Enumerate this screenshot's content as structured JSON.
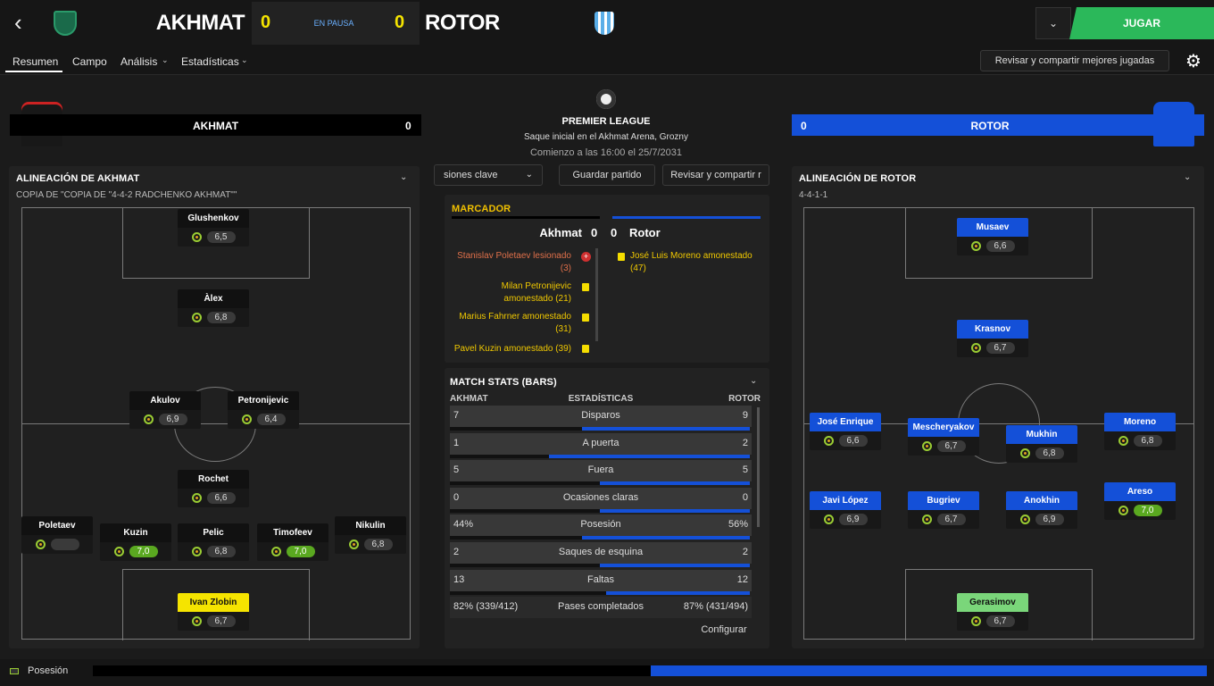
{
  "header": {
    "home_name": "AKHMAT",
    "away_name": "ROTOR",
    "home_score": "0",
    "away_score": "0",
    "status": "EN PAUSA",
    "play_label": "JUGAR"
  },
  "tabs": {
    "resumen": "Resumen",
    "campo": "Campo",
    "analisis": "Análisis",
    "estadisticas": "Estadísticas",
    "share_best": "Revisar y compartir mejores jugadas"
  },
  "home_strip": {
    "name": "AKHMAT",
    "score": "0"
  },
  "away_strip": {
    "name": "ROTOR",
    "score": "0"
  },
  "center": {
    "league": "PREMIER LEAGUE",
    "venue": "Saque inicial en el Akhmat Arena, Grozny",
    "start": "Comienzo a las 16:00 el 25/7/2031",
    "btn_ocasiones": "siones clave",
    "btn_save": "Guardar partido",
    "btn_share": "Revisar y compartir r"
  },
  "scoreboard": {
    "title": "MARCADOR",
    "home": "Akhmat",
    "away": "Rotor",
    "home_score": "0",
    "away_score": "0",
    "home_events": [
      {
        "text": "Stanislav Poletaev lesionado (3)",
        "type": "injury"
      },
      {
        "text": "Milan Petronijevic amonestado (21)",
        "type": "yellow"
      },
      {
        "text": "Marius Fahrner amonestado (31)",
        "type": "yellow"
      },
      {
        "text": "Pavel Kuzin amonestado (39)",
        "type": "yellow"
      }
    ],
    "away_events": [
      {
        "text": "José Luis Moreno amonestado (47)",
        "type": "yellow"
      }
    ]
  },
  "match_stats": {
    "title": "MATCH STATS (BARS)",
    "col_home": "AKHMAT",
    "col_mid": "ESTADÍSTICAS",
    "col_away": "ROTOR",
    "configure": "Configurar",
    "rows": [
      {
        "label": "Disparos",
        "home": "7",
        "away": "9",
        "home_frac": 0.44,
        "away_frac": 0.56
      },
      {
        "label": "A puerta",
        "home": "1",
        "away": "2",
        "home_frac": 0.33,
        "away_frac": 0.67
      },
      {
        "label": "Fuera",
        "home": "5",
        "away": "5",
        "home_frac": 0.5,
        "away_frac": 0.5
      },
      {
        "label": "Ocasiones claras",
        "home": "0",
        "away": "0",
        "home_frac": 0.5,
        "away_frac": 0.5
      },
      {
        "label": "Posesión",
        "home": "44%",
        "away": "56%",
        "home_frac": 0.44,
        "away_frac": 0.56
      },
      {
        "label": "Saques de esquina",
        "home": "2",
        "away": "2",
        "home_frac": 0.5,
        "away_frac": 0.5
      },
      {
        "label": "Faltas",
        "home": "13",
        "away": "12",
        "home_frac": 0.52,
        "away_frac": 0.48
      },
      {
        "label": "Pases completados",
        "home": "82% (339/412)",
        "away": "87% (431/494)",
        "home_frac": 0.49,
        "away_frac": 0.51
      }
    ]
  },
  "home_lineup": {
    "title": "ALINEACIÓN DE AKHMAT",
    "formation": "COPIA DE \"COPIA DE \"4-4-2 RADCHENKO AKHMAT\"\"",
    "players": [
      {
        "name": "Glushenkov",
        "rating": "6,5",
        "good": false,
        "style": ""
      },
      {
        "name": "Àlex",
        "rating": "6,8",
        "good": false,
        "style": ""
      },
      {
        "name": "Akulov",
        "rating": "6,9",
        "good": false,
        "style": ""
      },
      {
        "name": "Petronijevic",
        "rating": "6,4",
        "good": false,
        "style": ""
      },
      {
        "name": "Rochet",
        "rating": "6,6",
        "good": false,
        "style": ""
      },
      {
        "name": "Poletaev",
        "rating": "",
        "good": false,
        "style": ""
      },
      {
        "name": "Kuzin",
        "rating": "7,0",
        "good": true,
        "style": ""
      },
      {
        "name": "Pelic",
        "rating": "6,8",
        "good": false,
        "style": ""
      },
      {
        "name": "Timofeev",
        "rating": "7,0",
        "good": true,
        "style": ""
      },
      {
        "name": "Nikulin",
        "rating": "6,8",
        "good": false,
        "style": ""
      },
      {
        "name": "Ivan Zlobin",
        "rating": "6,7",
        "good": false,
        "style": "yellow"
      }
    ]
  },
  "away_lineup": {
    "title": "ALINEACIÓN DE ROTOR",
    "formation": "4-4-1-1",
    "players": [
      {
        "name": "Musaev",
        "rating": "6,6",
        "good": false,
        "style": "blue"
      },
      {
        "name": "Krasnov",
        "rating": "6,7",
        "good": false,
        "style": "blue"
      },
      {
        "name": "José Enrique",
        "rating": "6,6",
        "good": false,
        "style": "blue"
      },
      {
        "name": "Mescheryakov",
        "rating": "6,7",
        "good": false,
        "style": "blue"
      },
      {
        "name": "Mukhin",
        "rating": "6,8",
        "good": false,
        "style": "blue"
      },
      {
        "name": "Moreno",
        "rating": "6,8",
        "good": false,
        "style": "blue"
      },
      {
        "name": "Javi López",
        "rating": "6,9",
        "good": false,
        "style": "blue"
      },
      {
        "name": "Bugriev",
        "rating": "6,7",
        "good": false,
        "style": "blue"
      },
      {
        "name": "Anokhin",
        "rating": "6,9",
        "good": false,
        "style": "blue"
      },
      {
        "name": "Areso",
        "rating": "7,0",
        "good": true,
        "style": "blue"
      },
      {
        "name": "Gerasimov",
        "rating": "6,7",
        "good": false,
        "style": "green"
      }
    ]
  },
  "possession_bar": {
    "label": "Posesión",
    "home_frac": 0.44,
    "away_frac": 0.56
  },
  "colors": {
    "accent_green": "#2bb85a",
    "away_blue": "#1450d8",
    "yellow": "#f5e400"
  }
}
